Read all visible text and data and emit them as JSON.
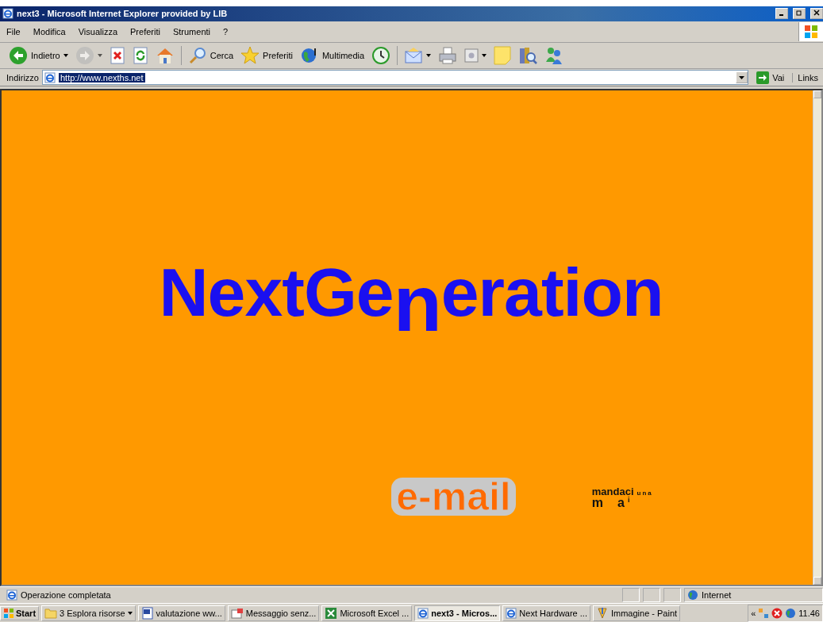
{
  "window": {
    "title": "next3 - Microsoft Internet Explorer provided by LIB"
  },
  "menu": [
    "File",
    "Modifica",
    "Visualizza",
    "Preferiti",
    "Strumenti",
    "?"
  ],
  "toolbar": [
    {
      "label": "Indietro",
      "dropdown": true,
      "disabled": false
    },
    {
      "dropdown": true,
      "disabled": true
    },
    {
      "dropdown": false,
      "disabled": false
    },
    {
      "dropdown": false,
      "disabled": false
    },
    {
      "dropdown": false,
      "disabled": false
    },
    {
      "label": "Cerca",
      "dropdown": false,
      "disabled": false
    },
    {
      "label": "Preferiti",
      "dropdown": false,
      "disabled": false
    },
    {
      "label": "Multimedia",
      "dropdown": false,
      "disabled": false
    },
    {
      "dropdown": false,
      "disabled": false
    },
    {
      "dropdown": true,
      "disabled": false
    },
    {
      "dropdown": false,
      "disabled": false
    },
    {
      "dropdown": true,
      "disabled": false
    },
    {
      "dropdown": false,
      "disabled": false
    },
    {
      "dropdown": false,
      "disabled": false
    },
    {
      "dropdown": false,
      "disabled": false
    }
  ],
  "address": {
    "label": "Indirizzo",
    "value": "http://www.nexths.net",
    "go": "Vai",
    "links": "Links"
  },
  "page": {
    "logo": [
      {
        "text": "NextGe",
        "kind": "normal"
      },
      {
        "text": "n",
        "kind": "dropped"
      },
      {
        "text": "eration",
        "kind": "normal"
      }
    ],
    "email_button": "e-mail",
    "note": {
      "line1": "mandaci",
      "line1_small": "una",
      "line2": [
        "m",
        "a",
        "i"
      ]
    }
  },
  "status_bar": {
    "text": "Operazione completata",
    "zone": "Internet"
  },
  "taskbar": {
    "start": "Start",
    "items": [
      {
        "label": "3 Esplora risorse",
        "dropdown": true,
        "selected": false
      },
      {
        "label": "valutazione ww...",
        "dropdown": false,
        "selected": false
      },
      {
        "label": "Messaggio senz...",
        "dropdown": false,
        "selected": false
      },
      {
        "label": "Microsoft Excel ...",
        "dropdown": false,
        "selected": false
      },
      {
        "label": "next3 - Micros...",
        "dropdown": false,
        "selected": true
      },
      {
        "label": "Next Hardware ...",
        "dropdown": false,
        "selected": false
      },
      {
        "label": "Immagine - Paint",
        "dropdown": false,
        "selected": false
      }
    ],
    "tray_expand": "«",
    "clock": "11.46"
  }
}
